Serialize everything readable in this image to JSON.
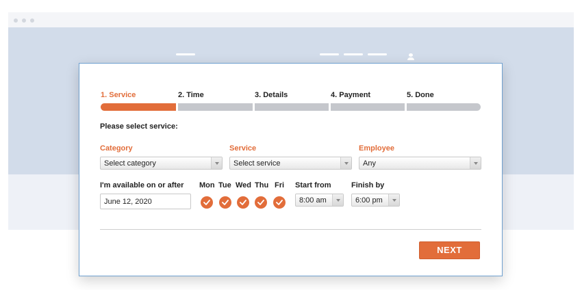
{
  "steps": [
    {
      "label": "1. Service",
      "active": true
    },
    {
      "label": "2. Time",
      "active": false
    },
    {
      "label": "3. Details",
      "active": false
    },
    {
      "label": "4. Payment",
      "active": false
    },
    {
      "label": "5. Done",
      "active": false
    }
  ],
  "prompt": "Please select service:",
  "fields": {
    "category": {
      "label": "Category",
      "value": "Select category"
    },
    "service": {
      "label": "Service",
      "value": "Select service"
    },
    "employee": {
      "label": "Employee",
      "value": "Any"
    }
  },
  "availability": {
    "label": "I'm available on or after",
    "date": "June 12, 2020"
  },
  "days": [
    {
      "label": "Mon",
      "checked": true
    },
    {
      "label": "Tue",
      "checked": true
    },
    {
      "label": "Wed",
      "checked": true
    },
    {
      "label": "Thu",
      "checked": true
    },
    {
      "label": "Fri",
      "checked": true
    }
  ],
  "start_from": {
    "label": "Start from",
    "value": "8:00 am"
  },
  "finish_by": {
    "label": "Finish by",
    "value": "6:00 pm"
  },
  "next_label": "NEXT",
  "colors": {
    "accent": "#e26d3a",
    "inactive_step": "#c5c7cc",
    "hero_background": "#d2dcea",
    "modal_border": "#6fa0cf"
  },
  "icons": {
    "day_check": "check-icon",
    "dropdown": "chevron-down-icon",
    "account": "user-icon"
  }
}
